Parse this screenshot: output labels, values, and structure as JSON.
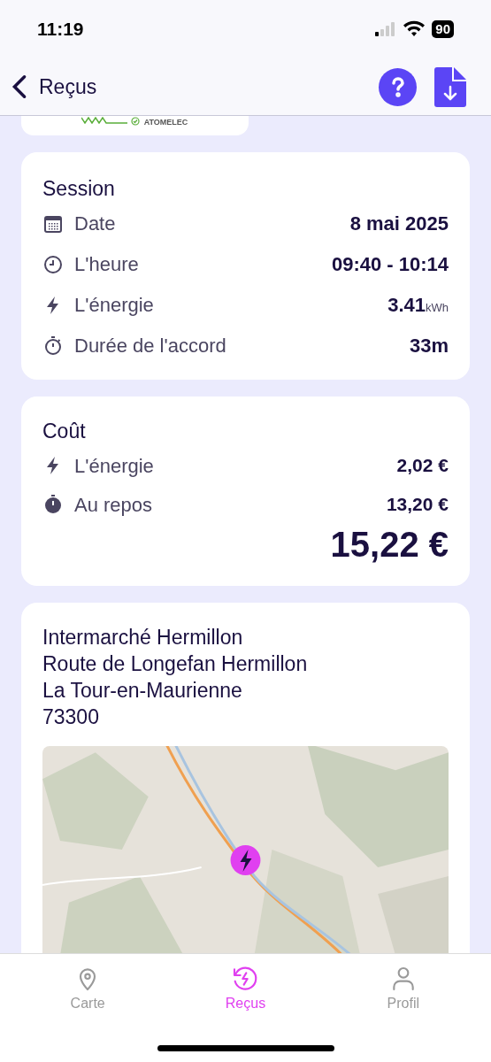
{
  "status_bar": {
    "time": "11:19",
    "battery": "90"
  },
  "header": {
    "back_label": "Reçus"
  },
  "logo": {
    "text": "ATOMELEC"
  },
  "session": {
    "title": "Session",
    "rows": [
      {
        "kind": "date",
        "label": "Date",
        "value": "8 mai 2025"
      },
      {
        "kind": "time",
        "label": "L'heure",
        "value": "09:40 - 10:14"
      },
      {
        "kind": "energy",
        "label": "L'énergie",
        "value": "3.41",
        "unit": "kWh"
      },
      {
        "kind": "duration",
        "label": "Durée de l'accord",
        "value": "33m"
      }
    ]
  },
  "cost": {
    "title": "Coût",
    "rows": [
      {
        "kind": "energy",
        "label": "L'énergie",
        "value": "2,02 €"
      },
      {
        "kind": "idle",
        "label": "Au repos",
        "value": "13,20 €"
      }
    ],
    "total": "15,22 €"
  },
  "location": {
    "lines": [
      "Intermarché Hermillon",
      "Route de Longefan Hermillon",
      "La Tour-en-Maurienne",
      "73300"
    ]
  },
  "tabs": [
    {
      "kind": "map",
      "label": "Carte",
      "selected": false
    },
    {
      "kind": "receipts",
      "label": "Reçus",
      "selected": true
    },
    {
      "kind": "profile",
      "label": "Profil",
      "selected": false
    }
  ]
}
